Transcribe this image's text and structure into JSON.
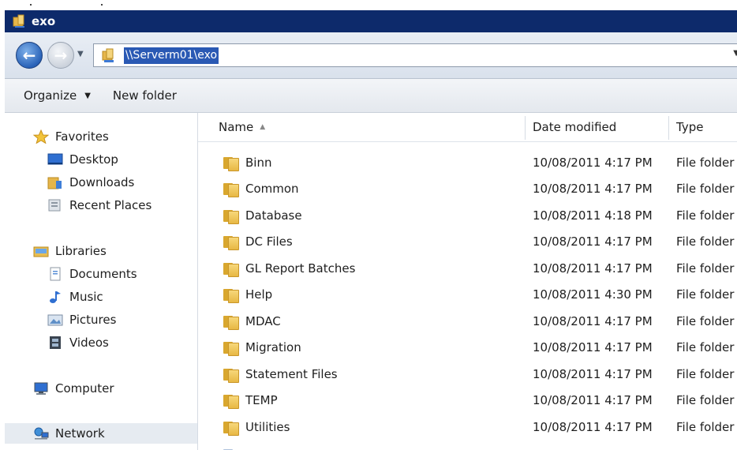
{
  "window": {
    "title": "exo"
  },
  "address": {
    "path": "\\\\Serverm01\\exo"
  },
  "toolbar": {
    "organize": "Organize",
    "new_folder": "New folder"
  },
  "nav": {
    "favorites": "Favorites",
    "desktop": "Desktop",
    "downloads": "Downloads",
    "recent": "Recent Places",
    "libraries": "Libraries",
    "documents": "Documents",
    "music": "Music",
    "pictures": "Pictures",
    "videos": "Videos",
    "computer": "Computer",
    "network": "Network"
  },
  "columns": {
    "name": "Name",
    "date": "Date modified",
    "type": "Type"
  },
  "files": [
    {
      "name": "Binn",
      "date": "10/08/2011 4:17 PM",
      "type": "File folder"
    },
    {
      "name": "Common",
      "date": "10/08/2011 4:17 PM",
      "type": "File folder"
    },
    {
      "name": "Database",
      "date": "10/08/2011 4:18 PM",
      "type": "File folder"
    },
    {
      "name": "DC Files",
      "date": "10/08/2011 4:17 PM",
      "type": "File folder"
    },
    {
      "name": "GL Report Batches",
      "date": "10/08/2011 4:17 PM",
      "type": "File folder"
    },
    {
      "name": "Help",
      "date": "10/08/2011 4:30 PM",
      "type": "File folder"
    },
    {
      "name": "MDAC",
      "date": "10/08/2011 4:17 PM",
      "type": "File folder"
    },
    {
      "name": "Migration",
      "date": "10/08/2011 4:17 PM",
      "type": "File folder"
    },
    {
      "name": "Statement Files",
      "date": "10/08/2011 4:17 PM",
      "type": "File folder"
    },
    {
      "name": "TEMP",
      "date": "10/08/2011 4:17 PM",
      "type": "File folder"
    },
    {
      "name": "Utilities",
      "date": "10/08/2011 4:17 PM",
      "type": "File folder"
    }
  ],
  "colors": {
    "titlebar": "#0d2a6b",
    "selection": "#2a59b4",
    "folder": "#e8b844"
  }
}
